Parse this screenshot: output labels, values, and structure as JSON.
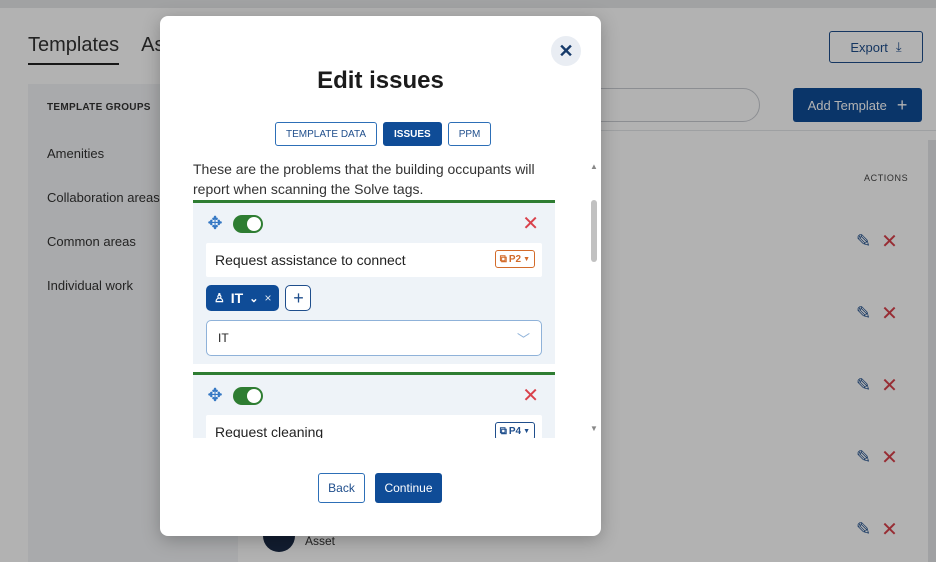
{
  "page": {
    "tabs": [
      {
        "label": "Templates"
      },
      {
        "label": "Assets"
      }
    ],
    "export_label": "Export",
    "add_template_label": "Add Template",
    "template_groups_header": "TEMPLATE GROUPS",
    "template_groups": [
      "Amenities",
      "Collaboration areas",
      "Common areas",
      "Individual work"
    ],
    "actions_header": "ACTIONS",
    "asset_label": "Asset"
  },
  "modal": {
    "title": "Edit issues",
    "tabs": [
      {
        "label": "TEMPLATE DATA",
        "active": false
      },
      {
        "label": "ISSUES",
        "active": true
      },
      {
        "label": "PPM",
        "active": false
      }
    ],
    "description": "These are the problems that the building occupants will report when scanning the Solve tags.",
    "issues": [
      {
        "name": "Request assistance to connect",
        "priority": "P2",
        "priority_color": "#d36b2a",
        "enabled": true,
        "team_chip": "IT",
        "team_select": "IT"
      },
      {
        "name": "Request cleaning",
        "priority": "P4",
        "priority_color": "#1f4e8c",
        "enabled": true
      }
    ],
    "back_label": "Back",
    "continue_label": "Continue"
  },
  "icons": {
    "close": "close-icon",
    "move": "move-icon",
    "delete": "delete-icon",
    "user": "user-icon",
    "chevron": "chevron-down-icon",
    "add": "plus-icon",
    "edit": "pencil-icon",
    "export": "download-icon"
  },
  "colors": {
    "primary": "#0f4c97",
    "success": "#2e7d32",
    "danger": "#d9414b",
    "priority_high": "#d36b2a"
  }
}
